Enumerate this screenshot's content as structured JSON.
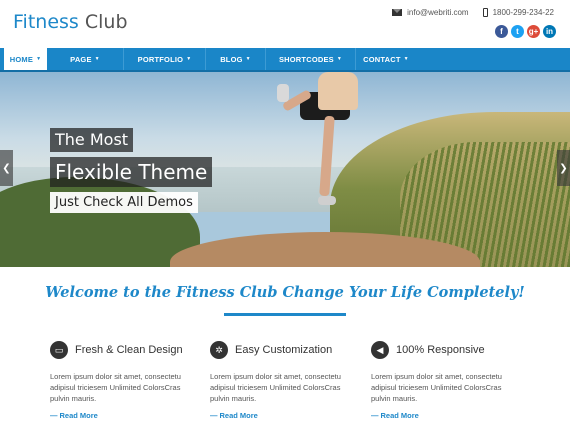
{
  "header": {
    "logo_part1": "Fitness",
    "logo_part2": "Club",
    "email": "info@webriti.com",
    "phone": "1800-299-234-22",
    "social": [
      {
        "icon": "facebook-icon",
        "glyph": "f",
        "color": "#3b5998"
      },
      {
        "icon": "twitter-icon",
        "glyph": "t",
        "color": "#1da1f2"
      },
      {
        "icon": "google-plus-icon",
        "glyph": "g+",
        "color": "#dd4b39"
      },
      {
        "icon": "linkedin-icon",
        "glyph": "in",
        "color": "#0077b5"
      }
    ]
  },
  "nav": {
    "items": [
      {
        "label": "HOME",
        "caret": "▼"
      },
      {
        "label": "PAGE",
        "caret": "▼"
      },
      {
        "label": "PORTFOLIO",
        "caret": "▼"
      },
      {
        "label": "BLOG",
        "caret": "▼"
      },
      {
        "label": "SHORTCODES",
        "caret": "▼"
      },
      {
        "label": "CONTACT",
        "caret": "▼"
      }
    ]
  },
  "hero": {
    "caption1": "The Most",
    "caption2": "Flexible Theme",
    "caption3": "Just Check All Demos",
    "prev_glyph": "❮",
    "next_glyph": "❯"
  },
  "welcome": {
    "title": "Welcome to the Fitness Club Change Your Life Completely!"
  },
  "features": [
    {
      "title": "Fresh & Clean Design",
      "icon": "monitor-icon",
      "glyph": "▭",
      "text": "Lorem ipsum dolor sit amet, consectetu adipisul triciesem Unlimited ColorsCras pulvin mauris.",
      "more": "Read More"
    },
    {
      "title": "Easy Customization",
      "icon": "gear-icon",
      "glyph": "✲",
      "text": "Lorem ipsum dolor sit amet, consectetu adipisul triciesem Unlimited ColorsCras pulvin mauris.",
      "more": "Read More"
    },
    {
      "title": "100% Responsive",
      "icon": "megaphone-icon",
      "glyph": "◀",
      "text": "Lorem ipsum dolor sit amet, consectetu adipisul triciesem Unlimited ColorsCras pulvin mauris.",
      "more": "Read More"
    }
  ],
  "colors": {
    "accent": "#1e88c9",
    "nav_bg": "#1a86c8"
  }
}
